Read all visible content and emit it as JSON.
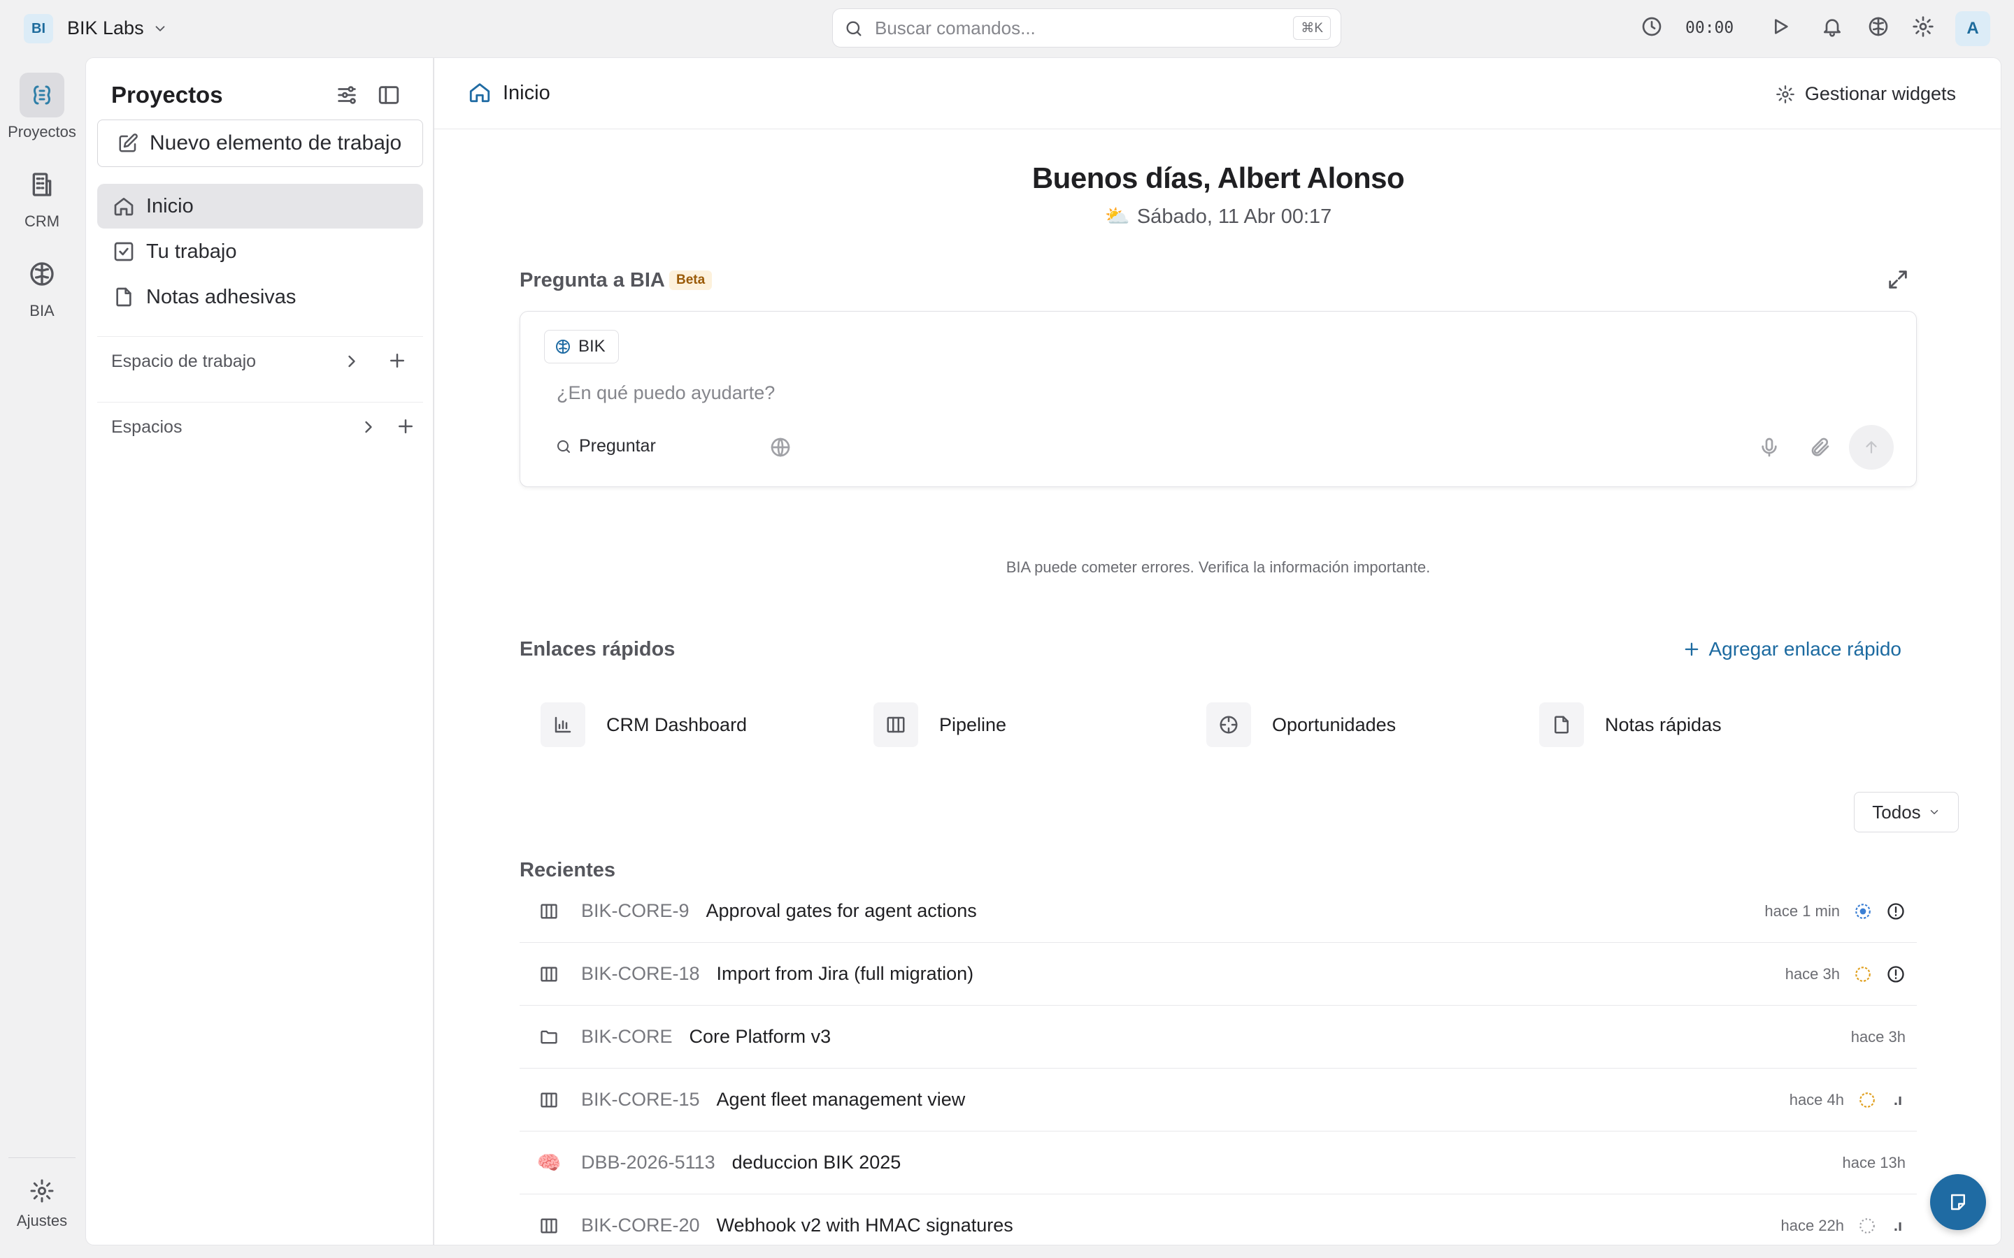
{
  "workspace": {
    "badge": "BI",
    "name": "BIK Labs"
  },
  "search": {
    "placeholder": "Buscar comandos...",
    "shortcut": "⌘K"
  },
  "timer": {
    "value": "00:00"
  },
  "user": {
    "initial": "A"
  },
  "rail": {
    "items": [
      {
        "label": "Proyectos",
        "icon": "projects-icon",
        "active": true
      },
      {
        "label": "CRM",
        "icon": "building-icon"
      },
      {
        "label": "BIA",
        "icon": "brain-icon"
      }
    ],
    "settings_label": "Ajustes"
  },
  "sidebar": {
    "title": "Proyectos",
    "new_item_label": "Nuevo elemento de trabajo",
    "nav": [
      {
        "label": "Inicio",
        "icon": "home-icon",
        "active": true
      },
      {
        "label": "Tu trabajo",
        "icon": "check-square-icon"
      },
      {
        "label": "Notas adhesivas",
        "icon": "file-icon"
      }
    ],
    "sections": [
      {
        "label": "Espacio de trabajo"
      },
      {
        "label": "Espacios"
      }
    ]
  },
  "header": {
    "title": "Inicio",
    "manage_widgets": "Gestionar widgets"
  },
  "greeting": {
    "text": "Buenos días, Albert Alonso",
    "date": "Sábado, 11 Abr 00:17",
    "weather_icon": "⛅"
  },
  "ask": {
    "title": "Pregunta a BIA",
    "badge": "Beta",
    "chip": "BIK",
    "placeholder": "¿En qué puedo ayudarte?",
    "ask_label": "Preguntar",
    "disclaimer": "BIA puede cometer errores. Verifica la información importante."
  },
  "quick_links": {
    "title": "Enlaces rápidos",
    "add_label": "Agregar enlace rápido",
    "items": [
      {
        "label": "CRM Dashboard",
        "icon": "bar-chart-icon"
      },
      {
        "label": "Pipeline",
        "icon": "columns-icon"
      },
      {
        "label": "Oportunidades",
        "icon": "crosshair-icon"
      },
      {
        "label": "Notas rápidas",
        "icon": "file-icon"
      }
    ]
  },
  "recents": {
    "title": "Recientes",
    "filter": "Todos",
    "rows": [
      {
        "key": "BIK-CORE-9",
        "name": "Approval gates for agent actions",
        "time": "hace 1 min",
        "icon": "board-icon",
        "status": "in-progress",
        "status_color": "#3b7fd4",
        "priority": "urgent"
      },
      {
        "key": "BIK-CORE-18",
        "name": "Import from Jira (full migration)",
        "time": "hace 3h",
        "icon": "board-icon",
        "status": "todo",
        "status_color": "#e0a020",
        "priority": "urgent"
      },
      {
        "key": "BIK-CORE",
        "name": "Core Platform v3",
        "time": "hace 3h",
        "icon": "folder-icon"
      },
      {
        "key": "BIK-CORE-15",
        "name": "Agent fleet management view",
        "time": "hace 4h",
        "icon": "board-icon",
        "status": "todo",
        "status_color": "#e0a020",
        "priority_mark": ".ı"
      },
      {
        "key": "DBB-2026-5113",
        "name": "deduccion BIK 2025",
        "time": "hace 13h",
        "icon": "brain-emoji-icon",
        "emoji": "🧠"
      },
      {
        "key": "BIK-CORE-20",
        "name": "Webhook v2 with HMAC signatures",
        "time": "hace 22h",
        "icon": "board-icon",
        "status": "backlog",
        "status_color": "#9a9ba0",
        "priority_mark": ".ı"
      }
    ]
  }
}
